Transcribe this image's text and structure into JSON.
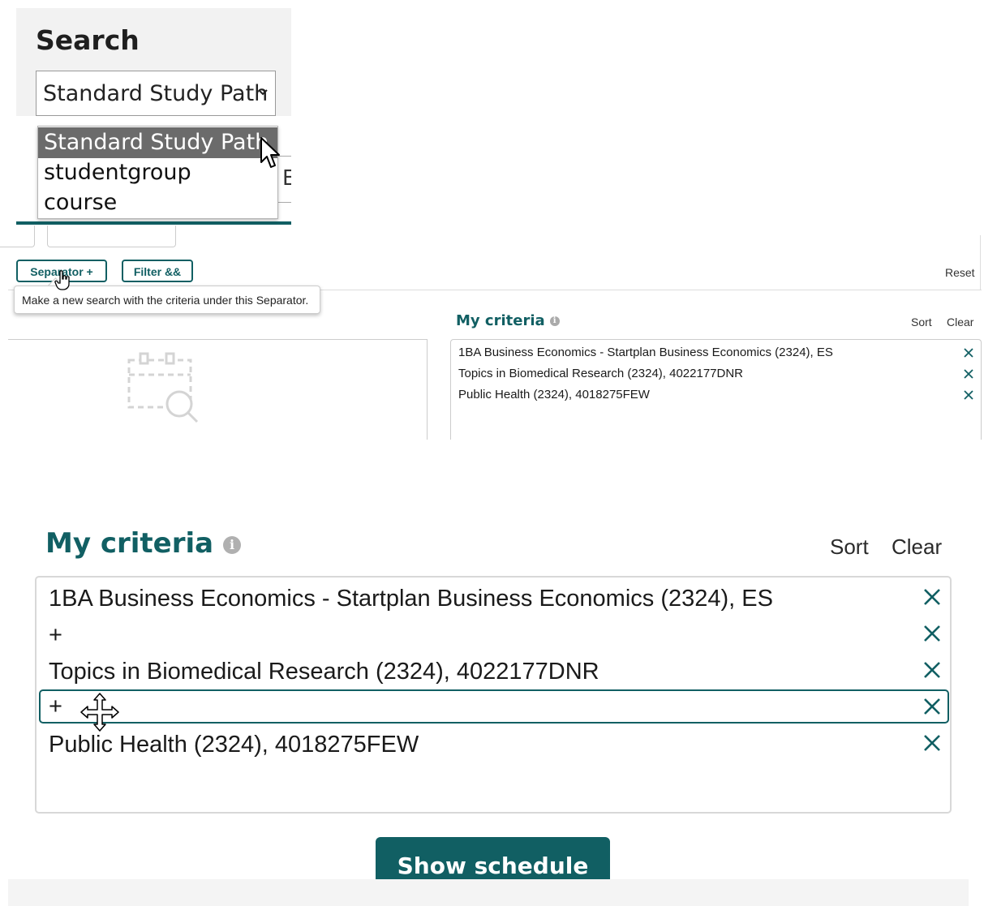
{
  "search_panel": {
    "title": "Search",
    "select_value": "Standard Study Path",
    "options": [
      "Standard Study Path",
      "studentgroup",
      "course"
    ],
    "partial_field_text": "E"
  },
  "toolbar": {
    "separator_button": "Separator +",
    "filter_button": "Filter &&",
    "reset_link": "Reset",
    "tooltip": "Make a new search with the criteria under this Separator."
  },
  "criteria_small": {
    "title": "My criteria",
    "info_icon": "i",
    "sort": "Sort",
    "clear": "Clear",
    "items": [
      "1BA Business Economics - Startplan Business Economics (2324), ES",
      "Topics in Biomedical Research (2324), 4022177DNR",
      "Public Health (2324), 4018275FEW"
    ]
  },
  "criteria_large": {
    "title": "My criteria",
    "info_icon": "i",
    "sort": "Sort",
    "clear": "Clear",
    "items": [
      "1BA Business Economics - Startplan Business Economics (2324), ES",
      "+",
      "Topics in Biomedical Research (2324), 4022177DNR",
      "+",
      "Public Health (2324), 4018275FEW"
    ],
    "show_schedule": "Show schedule"
  },
  "colors": {
    "accent": "#115f63",
    "selected_option_bg": "#6b6b6b",
    "panel_bg": "#f2f2f2"
  },
  "icons": [
    "chevron-down-icon",
    "arrow-cursor-icon",
    "hand-pointer-icon",
    "calendar-search-icon",
    "info-icon",
    "close-icon",
    "move-cursor-icon"
  ]
}
